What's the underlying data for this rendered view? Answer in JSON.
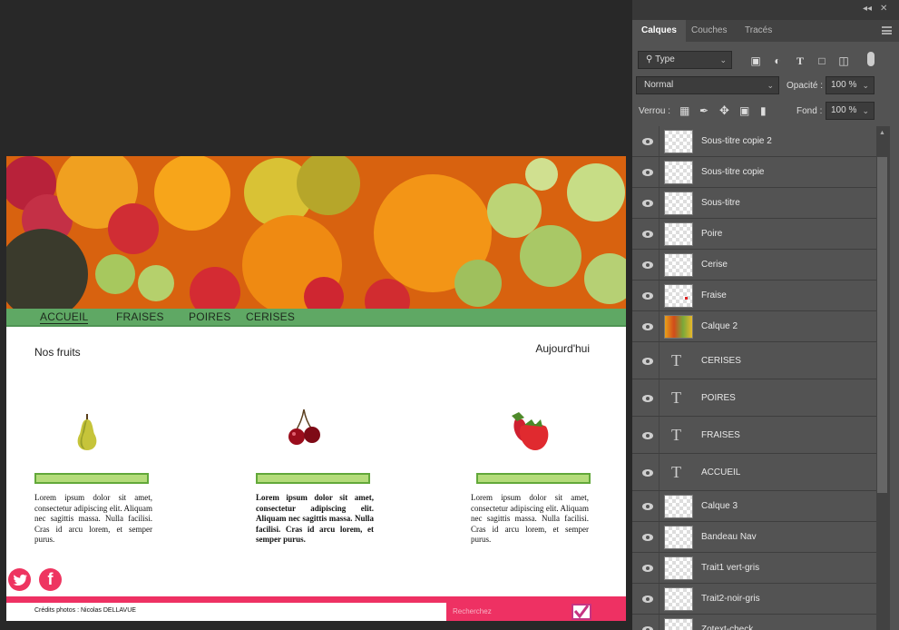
{
  "website": {
    "nav": [
      {
        "label": "ACCUEIL",
        "active": true
      },
      {
        "label": "FRAISES",
        "active": false
      },
      {
        "label": "POIRES",
        "active": false
      },
      {
        "label": "CERISES",
        "active": false
      }
    ],
    "section_title": "Nos fruits",
    "date_label": "Aujourd'hui",
    "cards": [
      {
        "fruit": "pear-image",
        "text": "Lorem ipsum dolor sit amet, consectetur adipiscing elit. Aliquam nec sagittis massa. Nulla facilisi. Cras id arcu lorem, et semper purus."
      },
      {
        "fruit": "cherry-image",
        "text": "Lorem ipsum dolor sit amet, consectetur adipiscing elit. Aliquam nec sagittis massa. Nulla facilisi. Cras id arcu lorem, et semper purus."
      },
      {
        "fruit": "strawberry-image",
        "text": "Lorem ipsum dolor sit amet, consectetur adipiscing elit. Aliquam nec sagittis massa. Nulla facilisi. Cras id arcu lorem, et semper purus."
      }
    ],
    "social": [
      "twitter-icon",
      "facebook-icon"
    ],
    "credits": "Crédits photos : Nicolas DELLAVUE",
    "search_placeholder": "Recherchez",
    "colors": {
      "nav_green": "#5fa864",
      "accent_pink": "#ee3163",
      "card_bar_fill": "#b4dc7a",
      "card_bar_border": "#62a83a"
    }
  },
  "panel": {
    "collapse_label": "◂◂",
    "close_label": "✕",
    "tabs": [
      {
        "label": "Calques",
        "active": true
      },
      {
        "label": "Couches",
        "active": false
      },
      {
        "label": "Tracés",
        "active": false
      }
    ],
    "filter_type": "Type",
    "blend_mode": "Normal",
    "opacity_label": "Opacité :",
    "opacity_value": "100 %",
    "lock_label": "Verrou :",
    "fill_label": "Fond :",
    "fill_value": "100 %",
    "layers": [
      {
        "name": "Sous-titre copie 2",
        "kind": "pixel"
      },
      {
        "name": "Sous-titre copie",
        "kind": "pixel"
      },
      {
        "name": "Sous-titre",
        "kind": "pixel"
      },
      {
        "name": "Poire",
        "kind": "pixel"
      },
      {
        "name": "Cerise",
        "kind": "pixel"
      },
      {
        "name": "Fraise",
        "kind": "pixel"
      },
      {
        "name": "Calque 2",
        "kind": "image"
      },
      {
        "name": "CERISES",
        "kind": "text"
      },
      {
        "name": "POIRES",
        "kind": "text"
      },
      {
        "name": "FRAISES",
        "kind": "text"
      },
      {
        "name": "ACCUEIL",
        "kind": "text"
      },
      {
        "name": "Calque 3",
        "kind": "pixel"
      },
      {
        "name": "Bandeau Nav",
        "kind": "pixel"
      },
      {
        "name": "Trait1 vert-gris",
        "kind": "pixel"
      },
      {
        "name": "Trait2-noir-gris",
        "kind": "pixel"
      },
      {
        "name": "Zotext-check",
        "kind": "pixel"
      }
    ]
  }
}
